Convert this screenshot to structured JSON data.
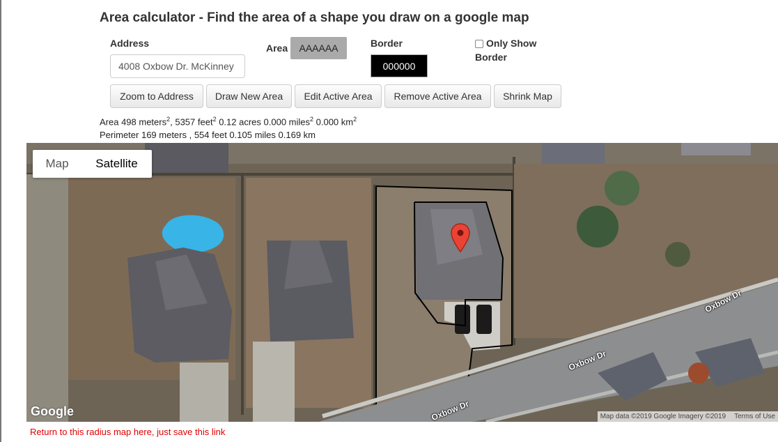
{
  "page_title": "Area calculator - Find the area of a shape you draw on a google map",
  "form": {
    "address_label": "Address",
    "address_value": "4008 Oxbow Dr. McKinney",
    "area_label": "Area",
    "area_color": "AAAAAA",
    "border_label": "Border",
    "border_color": "000000",
    "only_show_line1": "Only Show",
    "only_show_line2": "Border"
  },
  "buttons": {
    "zoom": "Zoom to Address",
    "draw": "Draw New Area",
    "edit": "Edit Active Area",
    "remove": "Remove Active Area",
    "shrink": "Shrink Map"
  },
  "stats": {
    "area_prefix": "Area 498 meters",
    "area_feet": ", 5357 feet",
    "area_acres": " 0.12 acres 0.000 miles",
    "area_km": " 0.000 km",
    "perimeter": "Perimeter 169 meters , 554 feet 0.105 miles 0.169 km"
  },
  "map": {
    "tab_map": "Map",
    "tab_satellite": "Satellite",
    "google": "Google",
    "attribution": "Map data ©2019 Google Imagery ©2019",
    "terms": "Terms of Use",
    "street": "Oxbow Dr",
    "pin_color": "#ea4335"
  },
  "footer": {
    "return_link": "Return to this radius map here, just save this link"
  }
}
